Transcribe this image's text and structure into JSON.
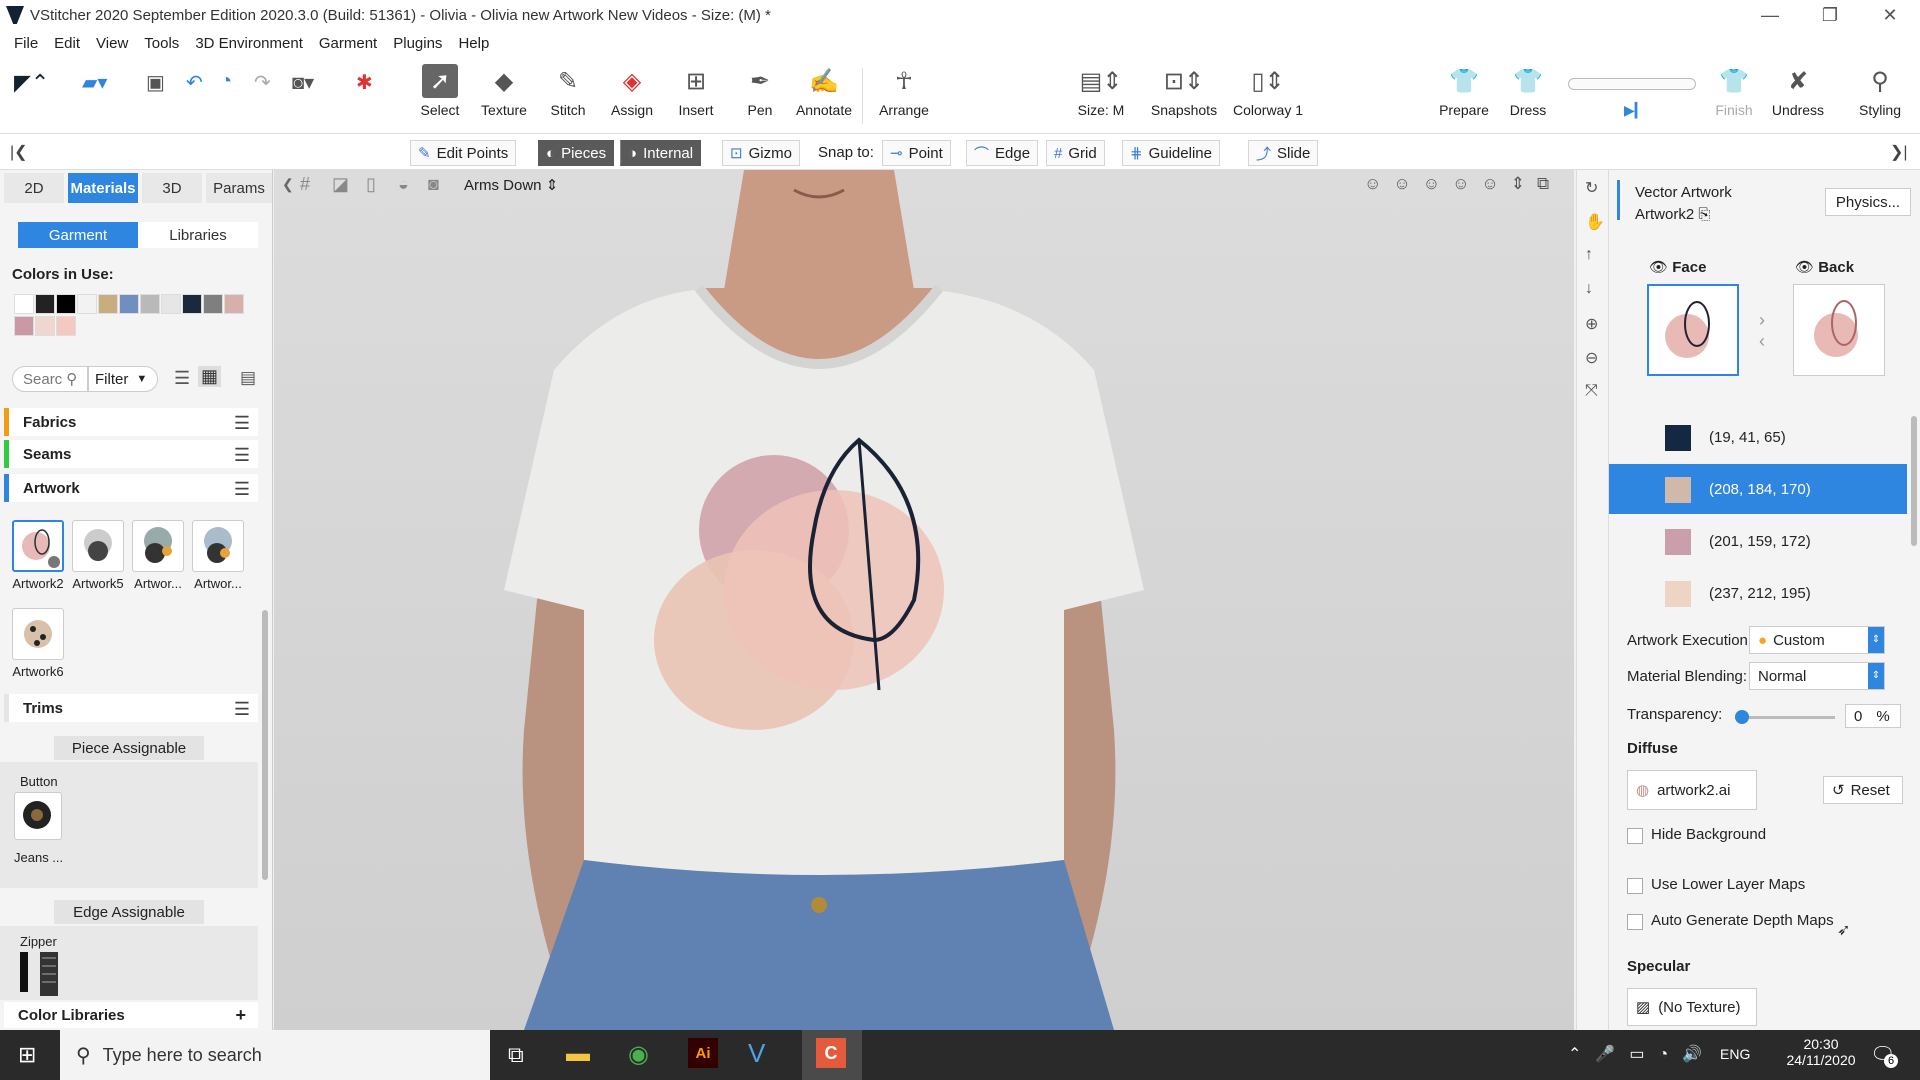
{
  "window": {
    "title": "VStitcher 2020 September Edition 2020.3.0 (Build: 51361) - Olivia - Olivia new Artwork New Videos - Size: (M) *"
  },
  "menu": [
    "File",
    "Edit",
    "View",
    "Tools",
    "3D Environment",
    "Garment",
    "Plugins",
    "Help"
  ],
  "toolbar": {
    "select": "Select",
    "texture": "Texture",
    "stitch": "Stitch",
    "assign": "Assign",
    "insert": "Insert",
    "pen": "Pen",
    "annotate": "Annotate",
    "arrange": "Arrange",
    "size": "Size: M",
    "snapshots": "Snapshots",
    "colorway": "Colorway 1",
    "prepare": "Prepare",
    "dress": "Dress",
    "finish": "Finish",
    "undress": "Undress",
    "styling": "Styling"
  },
  "bar2": {
    "edit_points": "Edit Points",
    "pieces": "Pieces",
    "internal": "Internal",
    "gizmo": "Gizmo",
    "snap_to": "Snap to:",
    "point": "Point",
    "edge": "Edge",
    "grid": "Grid",
    "guideline": "Guideline",
    "slide": "Slide"
  },
  "left": {
    "tabs": [
      "2D",
      "Materials",
      "3D",
      "Params"
    ],
    "subtabs": [
      "Garment",
      "Libraries"
    ],
    "colors_in_use_label": "Colors in Use:",
    "colors": [
      "#ffffff",
      "#222222",
      "#000000",
      "#f2f2f2",
      "#c9ad7e",
      "#6e8fbf",
      "#b9b9b9",
      "#e6e6e6",
      "#1a2840",
      "#7f7f7f",
      "#d6b0aa",
      "#c99aa5",
      "#efd6cf",
      "#f4c9c2"
    ],
    "search_placeholder": "Searc",
    "filter": "Filter",
    "sections": {
      "fabrics": "Fabrics",
      "seams": "Seams",
      "artwork": "Artwork",
      "trims": "Trims"
    },
    "artworks": [
      "Artwork2",
      "Artwork5",
      "Artwor...",
      "Artwor...",
      "Artwork6"
    ],
    "piece_assignable": "Piece Assignable",
    "button_label": "Button",
    "jeans_label": "Jeans ...",
    "edge_assignable": "Edge Assignable",
    "zipper_label": "Zipper",
    "color_libraries": "Color Libraries"
  },
  "viewport": {
    "pose": "Arms Down"
  },
  "right": {
    "header_title": "Vector Artwork",
    "header_sub": "Artwork2",
    "physics": "Physics...",
    "face": "Face",
    "back": "Back",
    "colors": [
      {
        "label": "(19, 41, 65)",
        "hex": "#132941"
      },
      {
        "label": "(208, 184, 170)",
        "hex": "#d0b8aa",
        "selected": true
      },
      {
        "label": "(201, 159, 172)",
        "hex": "#c99fac"
      },
      {
        "label": "(237, 212, 195)",
        "hex": "#edd4c3"
      }
    ],
    "artwork_execution_label": "Artwork Execution:",
    "artwork_execution": "Custom",
    "material_blending_label": "Material Blending:",
    "material_blending": "Normal",
    "transparency_label": "Transparency:",
    "transparency_value": "0",
    "transparency_unit": "%",
    "diffuse": "Diffuse",
    "diffuse_file": "artwork2.ai",
    "reset": "Reset",
    "hide_background": "Hide Background",
    "use_lower_layer_maps": "Use Lower Layer Maps",
    "auto_generate_depth_maps": "Auto Generate Depth Maps",
    "specular": "Specular",
    "no_texture": "(No Texture)"
  },
  "taskbar": {
    "search_placeholder": "Type here to search",
    "lang": "ENG",
    "time": "20:30",
    "date": "24/11/2020",
    "notif": "6"
  }
}
